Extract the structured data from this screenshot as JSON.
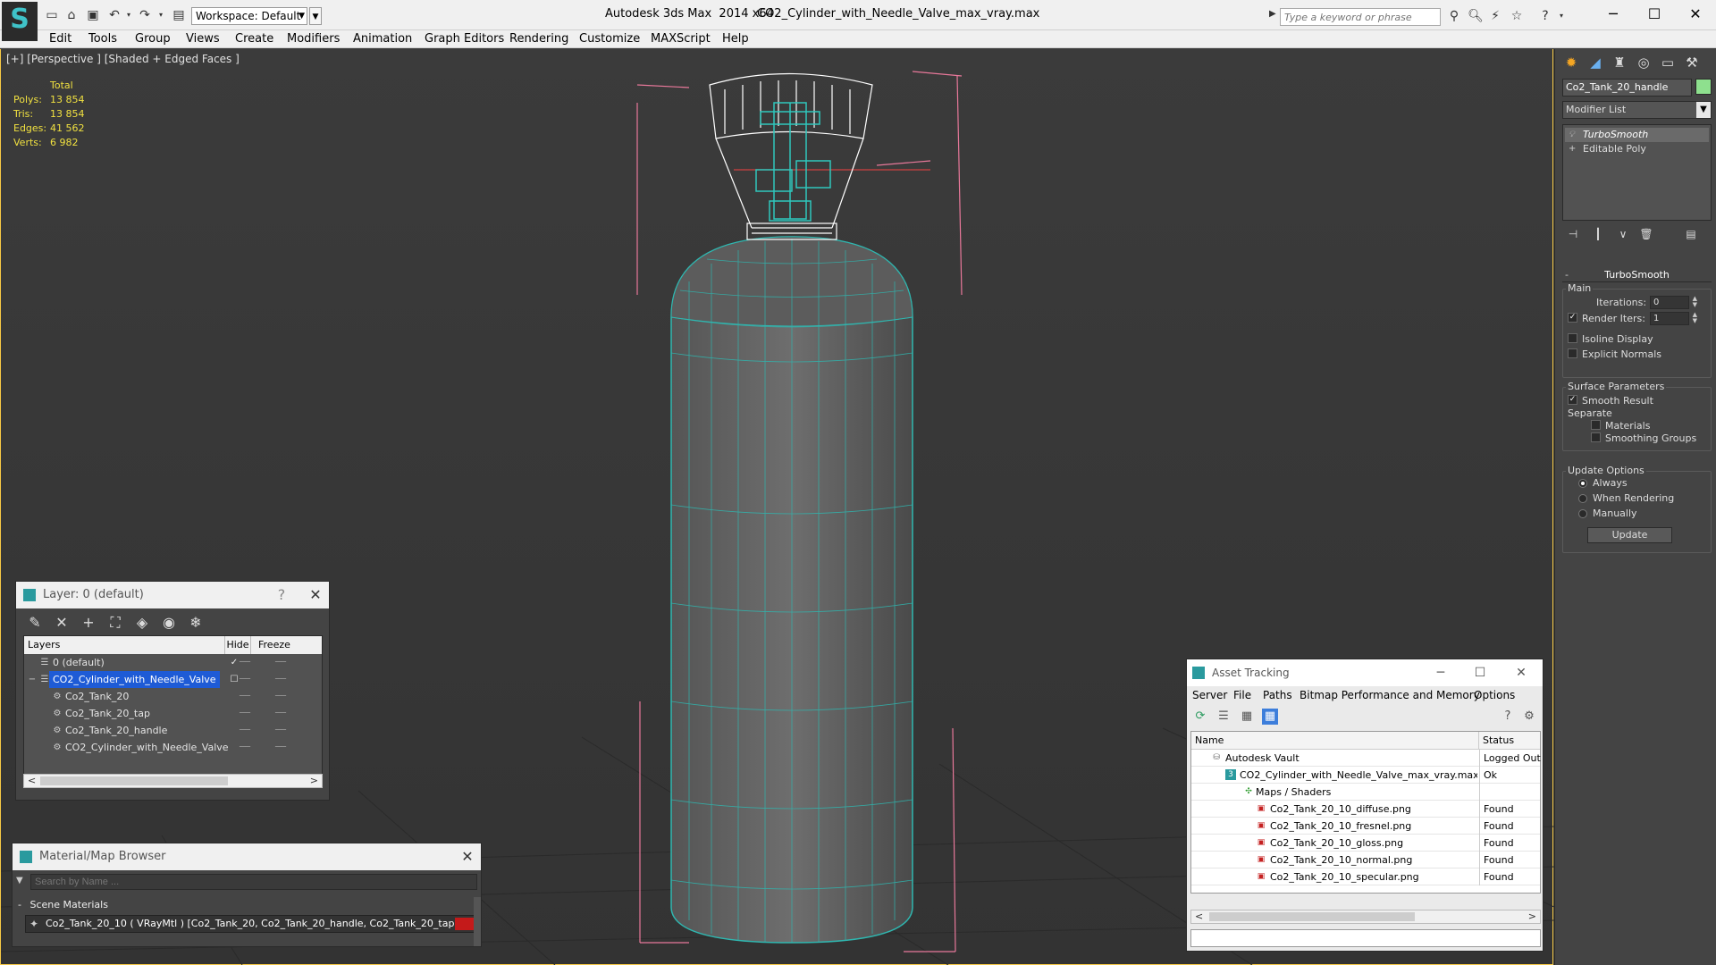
{
  "titlebar": {
    "workspace": "Workspace: Default",
    "app_title": "Autodesk 3ds Max  2014 x64",
    "file_title": "CO2_Cylinder_with_Needle_Valve_max_vray.max",
    "search_placeholder": "Type a keyword or phrase"
  },
  "menu": [
    "Edit",
    "Tools",
    "Group",
    "Views",
    "Create",
    "Modifiers",
    "Animation",
    "Graph Editors",
    "Rendering",
    "Customize",
    "MAXScript",
    "Help"
  ],
  "viewport": {
    "label": "[+] [Perspective ] [Shaded + Edged Faces ]",
    "stats": {
      "total_label": "Total",
      "rows": [
        {
          "label": "Polys:",
          "value": "13 854"
        },
        {
          "label": "Tris:",
          "value": "13 854"
        },
        {
          "label": "Edges:",
          "value": "41 562"
        },
        {
          "label": "Verts:",
          "value": "6 982"
        }
      ]
    }
  },
  "layer_panel": {
    "title": "Layer: 0 (default)",
    "help": "?",
    "columns": {
      "layers": "Layers",
      "hide": "Hide",
      "freeze": "Freeze"
    },
    "rows": [
      {
        "name": "0 (default)",
        "current": true
      },
      {
        "name": "CO2_Cylinder_with_Needle_Valve",
        "selected": true
      },
      {
        "name": "Co2_Tank_20"
      },
      {
        "name": "Co2_Tank_20_tap"
      },
      {
        "name": "Co2_Tank_20_handle"
      },
      {
        "name": "CO2_Cylinder_with_Needle_Valve"
      }
    ]
  },
  "material_browser": {
    "title": "Material/Map Browser",
    "search_placeholder": "Search by Name ...",
    "group": "Scene Materials",
    "item": "Co2_Tank_20_10  ( VRayMtl )  [Co2_Tank_20, Co2_Tank_20_handle, Co2_Tank_20_tap]",
    "swatch_color": "#c41a1a"
  },
  "asset_tracking": {
    "title": "Asset Tracking",
    "menu": [
      "Server",
      "File",
      "Paths",
      "Bitmap Performance and Memory",
      "Options"
    ],
    "columns": {
      "name": "Name",
      "status": "Status"
    },
    "rows": [
      {
        "name": "Autodesk Vault",
        "status": "Logged Out",
        "icon": "vault-icon"
      },
      {
        "name": "CO2_Cylinder_with_Needle_Valve_max_vray.max",
        "status": "Ok",
        "icon": "max-file-icon"
      },
      {
        "name": "Maps / Shaders",
        "status": "",
        "icon": "maps-icon"
      },
      {
        "name": "Co2_Tank_20_10_diffuse.png",
        "status": "Found",
        "icon": "png-icon"
      },
      {
        "name": "Co2_Tank_20_10_fresnel.png",
        "status": "Found",
        "icon": "png-icon"
      },
      {
        "name": "Co2_Tank_20_10_gloss.png",
        "status": "Found",
        "icon": "png-icon"
      },
      {
        "name": "Co2_Tank_20_10_normal.png",
        "status": "Found",
        "icon": "png-icon"
      },
      {
        "name": "Co2_Tank_20_10_specular.png",
        "status": "Found",
        "icon": "png-icon"
      }
    ]
  },
  "command_panel": {
    "object_name": "Co2_Tank_20_handle",
    "object_color": "#8ee08e",
    "modifier_list": "Modifier List",
    "stack": [
      {
        "name": "TurboSmooth",
        "active": true
      },
      {
        "name": "Editable Poly",
        "active": false
      }
    ],
    "turbosmooth": {
      "header": "TurboSmooth",
      "main_group": "Main",
      "iterations_label": "Iterations:",
      "iterations_value": "0",
      "render_iters_label": "Render Iters:",
      "render_iters_value": "1",
      "isoline_label": "Isoline Display",
      "explicit_normals_label": "Explicit Normals",
      "surface_group": "Surface Parameters",
      "smooth_result_label": "Smooth Result",
      "separate_label": "Separate",
      "materials_label": "Materials",
      "smoothing_groups_label": "Smoothing Groups",
      "update_group": "Update Options",
      "always_label": "Always",
      "when_rendering_label": "When Rendering",
      "manually_label": "Manually",
      "update_button": "Update",
      "render_iters_checked": true,
      "smooth_result_checked": true,
      "update_option_selected": "Always"
    }
  }
}
